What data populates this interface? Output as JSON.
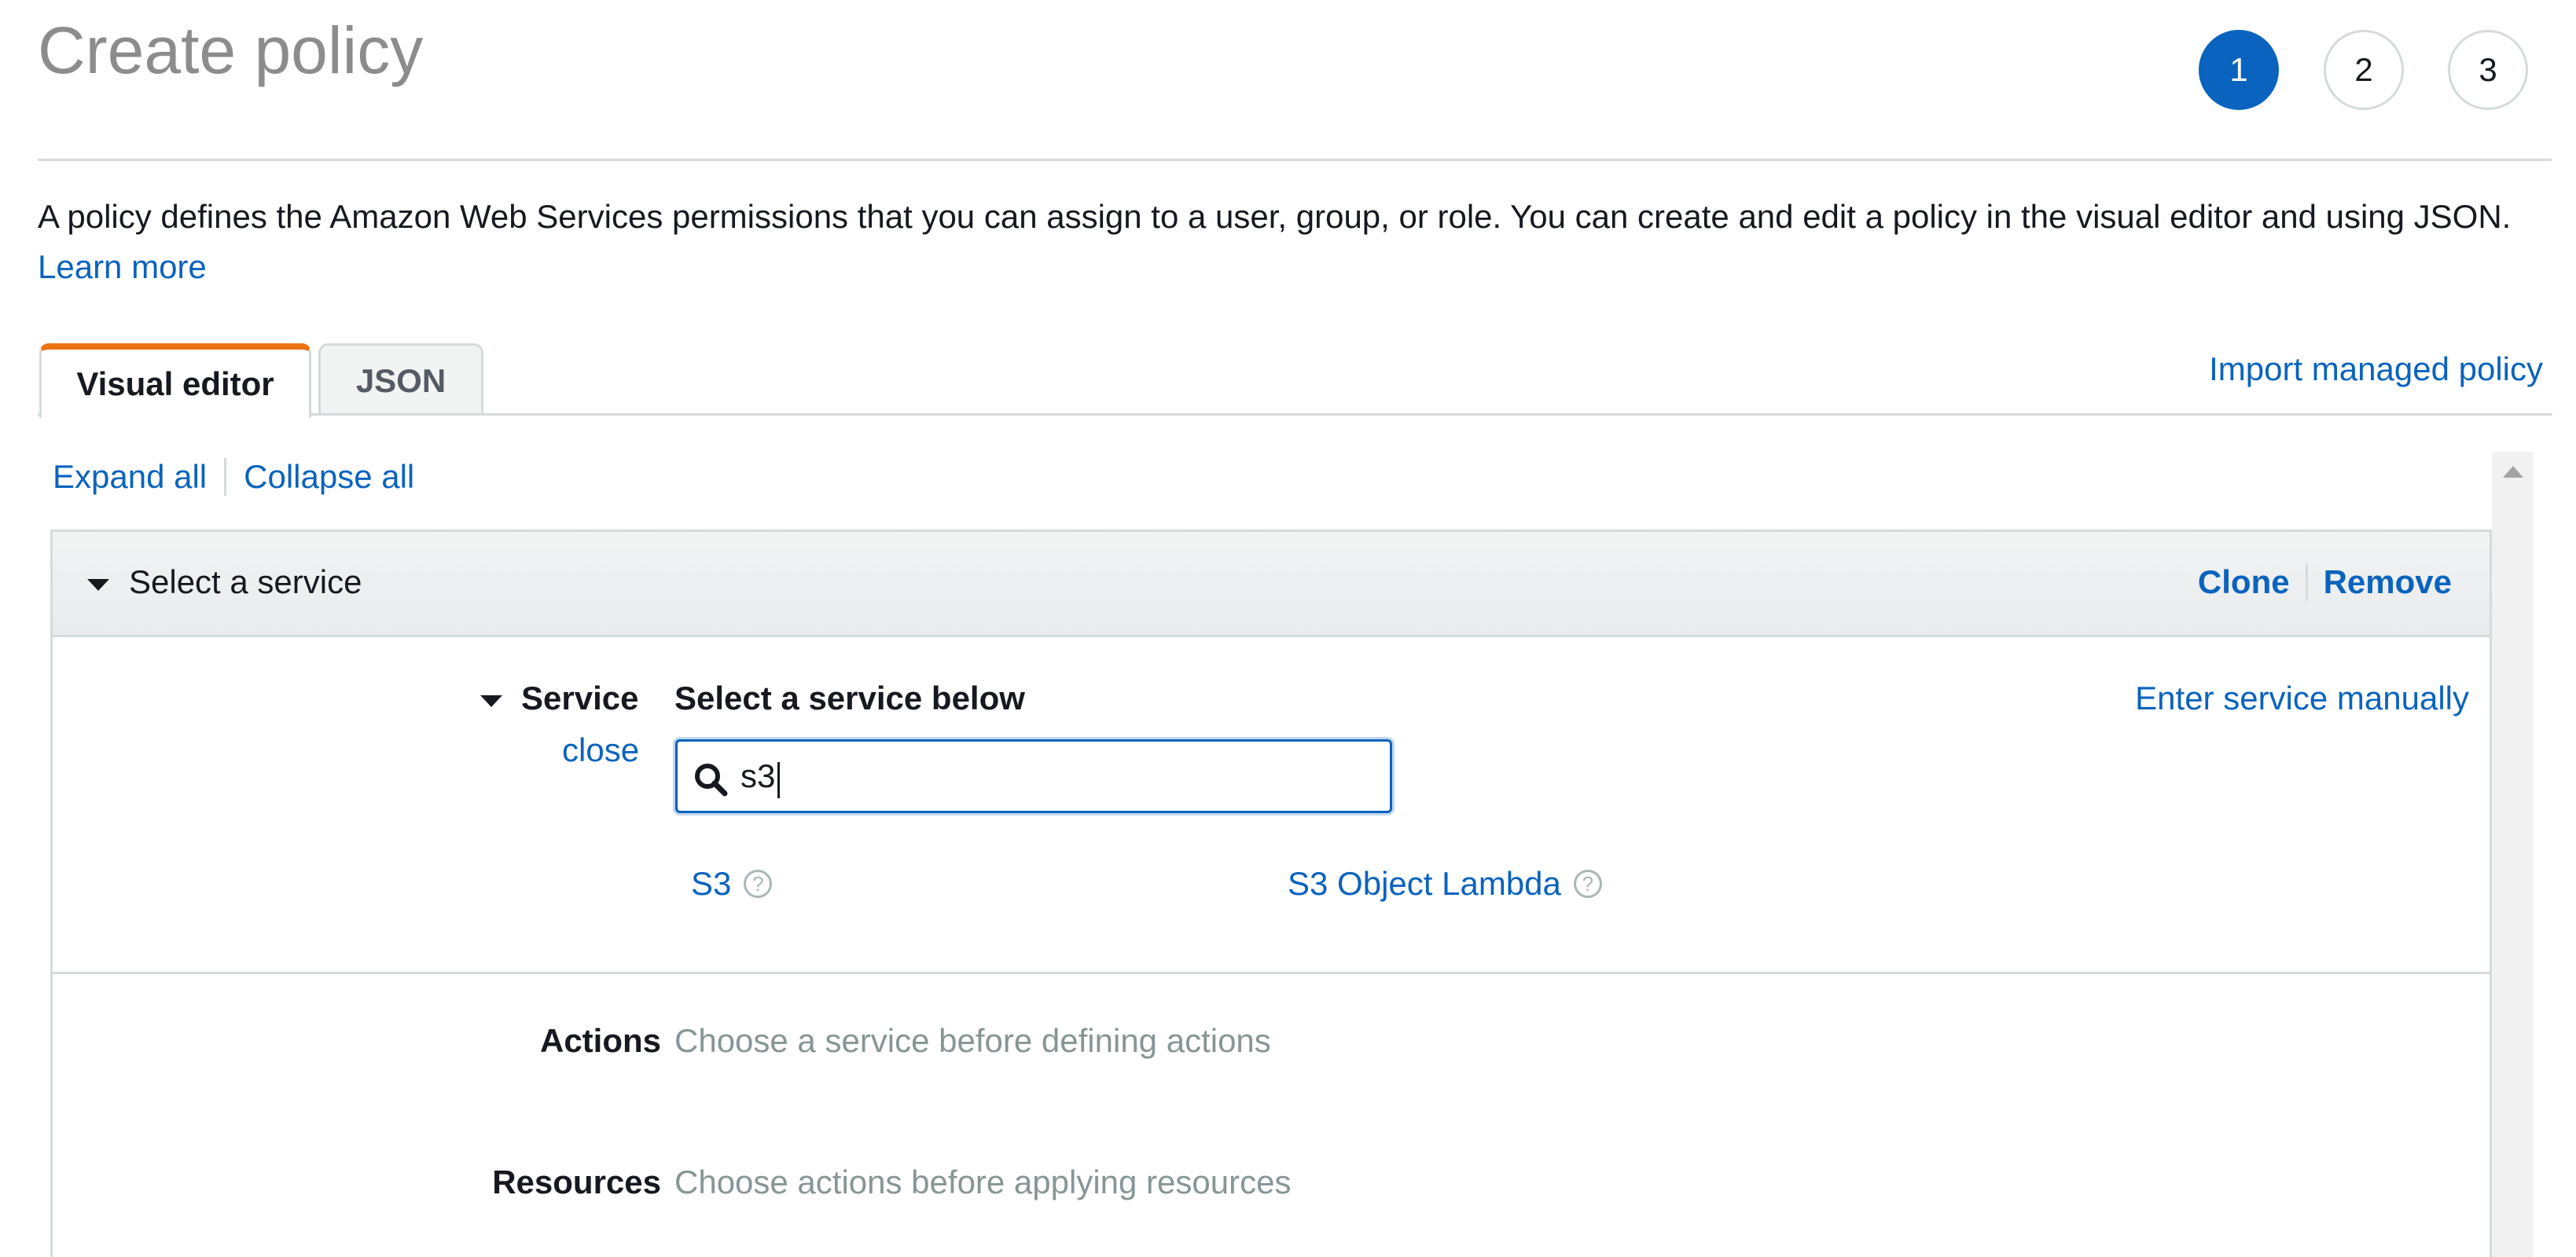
{
  "page": {
    "title": "Create policy",
    "steps": [
      "1",
      "2",
      "3"
    ],
    "active_step": "1",
    "description": "A policy defines the Amazon Web Services permissions that you can assign to a user, group, or role. You can create and edit a policy in the visual editor and using JSON.",
    "learn_more": "Learn more"
  },
  "tabs": {
    "visual_editor": "Visual editor",
    "json": "JSON",
    "active": "Visual editor",
    "import_managed_policy": "Import managed policy"
  },
  "toolbar": {
    "expand_all": "Expand all",
    "collapse_all": "Collapse all"
  },
  "statement": {
    "title": "Select a service",
    "clone": "Clone",
    "remove": "Remove",
    "service": {
      "label": "Service",
      "close": "close",
      "heading": "Select a service below",
      "enter_manually": "Enter service manually",
      "search_value": "s3",
      "results": [
        {
          "label": "S3",
          "help": "?"
        },
        {
          "label": "S3 Object Lambda",
          "help": "?"
        }
      ]
    },
    "actions": {
      "label": "Actions",
      "hint": "Choose a service before defining actions"
    },
    "resources": {
      "label": "Resources",
      "hint": "Choose actions before applying resources"
    }
  },
  "colors": {
    "accent": "#0a63be",
    "tab_highlight": "#ec7211",
    "title_gray": "#8c8c8c",
    "muted": "#879596"
  }
}
